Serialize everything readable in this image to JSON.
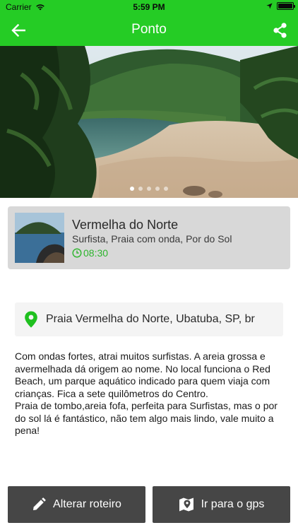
{
  "status_bar": {
    "carrier": "Carrier",
    "time": "5:59 PM",
    "battery_level": 1.0
  },
  "nav": {
    "title": "Ponto",
    "back_icon": "arrow-left-icon",
    "share_icon": "share-icon"
  },
  "hero": {
    "pages": 5,
    "active_page": 0
  },
  "place": {
    "name": "Vermelha do Norte",
    "tags": "Surfista, Praia com onda, Por do Sol",
    "time": "08:30"
  },
  "address": "Praia Vermelha do Norte, Ubatuba, SP, br",
  "description": "Com ondas fortes, atrai muitos surfistas. A areia grossa e avermelhada dá origem ao nome. No local funciona o Red Beach, um parque aquático indicado para quem viaja com crianças. Fica a sete quilômetros do Centro.\nPraia de tombo,areia fofa, perfeita para Surfistas, mas o por do sol lá é fantástico, não tem algo mais lindo, vale muito a pena!",
  "actions": {
    "edit_label": "Alterar roteiro",
    "gps_label": "Ir para o gps"
  },
  "colors": {
    "brand": "#25cc25",
    "accent_text": "#2db52d",
    "button_bg": "#464646",
    "card_bg": "#d8d8d8"
  }
}
